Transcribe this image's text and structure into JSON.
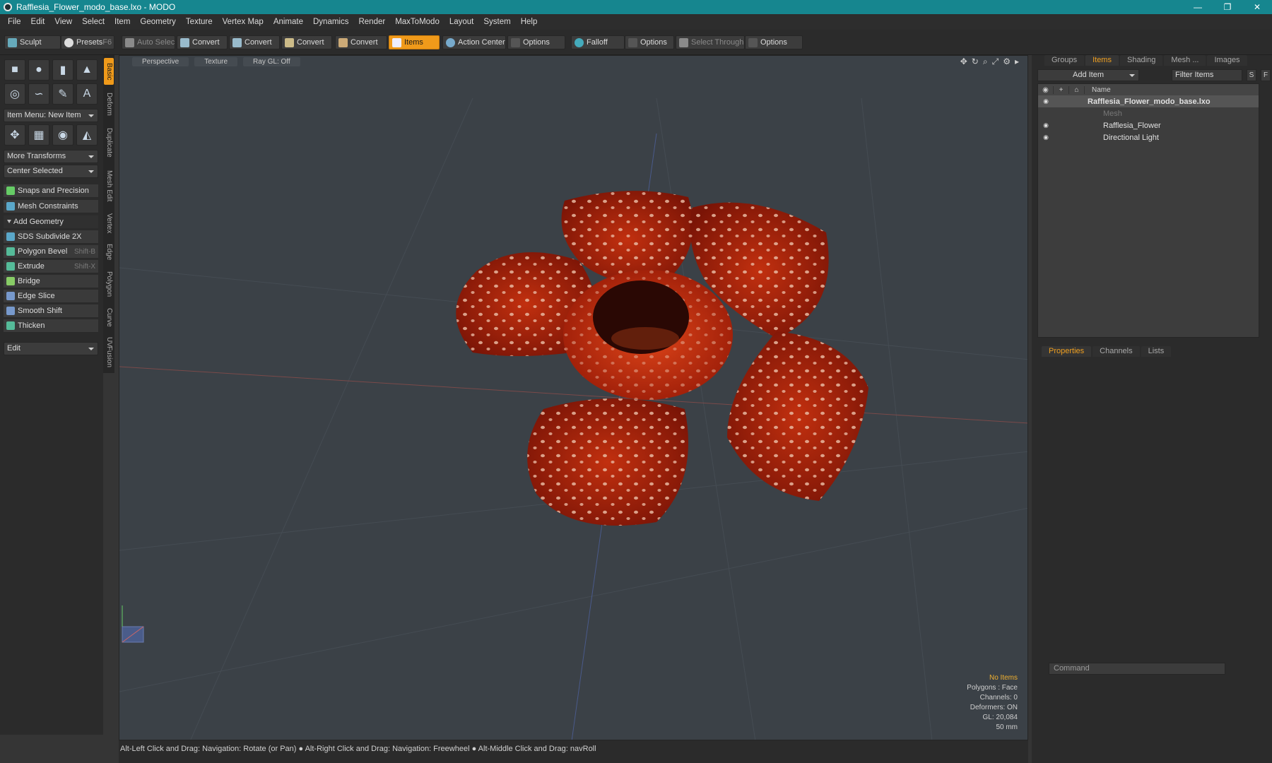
{
  "window": {
    "title": "Rafflesia_Flower_modo_base.lxo - MODO",
    "minimize": "—",
    "maximize": "❐",
    "close": "✕"
  },
  "menu": [
    "File",
    "Edit",
    "View",
    "Select",
    "Item",
    "Geometry",
    "Texture",
    "Vertex Map",
    "Animate",
    "Dynamics",
    "Render",
    "MaxToModo",
    "Layout",
    "System",
    "Help"
  ],
  "toolbar": {
    "sculpt": "Sculpt",
    "presets": "Presets",
    "presets_shortcut": "F6",
    "auto_select": "Auto Select",
    "convert1": "Convert",
    "convert2": "Convert",
    "convert3": "Convert",
    "convert4": "Convert",
    "items": "Items",
    "action_center": "Action Center",
    "options1": "Options",
    "falloff": "Falloff",
    "options2": "Options",
    "select_through": "Select Through",
    "options3": "Options"
  },
  "left": {
    "item_menu": "Item Menu: New Item",
    "more_transforms": "More Transforms",
    "center_selected": "Center Selected",
    "snaps": "Snaps and Precision",
    "mesh_constraints": "Mesh Constraints",
    "add_geometry": "Add Geometry",
    "tools": [
      {
        "label": "SDS Subdivide 2X",
        "shortcut": ""
      },
      {
        "label": "Polygon Bevel",
        "shortcut": "Shift-B"
      },
      {
        "label": "Extrude",
        "shortcut": "Shift-X"
      },
      {
        "label": "Bridge",
        "shortcut": ""
      },
      {
        "label": "Edge Slice",
        "shortcut": ""
      },
      {
        "label": "Smooth Shift",
        "shortcut": ""
      },
      {
        "label": "Thicken",
        "shortcut": ""
      }
    ],
    "edit": "Edit"
  },
  "vtabs": [
    "Basic",
    "Deform",
    "Duplicate",
    "Mesh Edit",
    "Vertex",
    "Edge",
    "Polygon",
    "Curve",
    "UV",
    "Fusion"
  ],
  "viewport": {
    "tabs": [
      "Perspective",
      "Texture",
      "Ray GL: Off"
    ],
    "info": {
      "no_items": "No Items",
      "polygons": "Polygons : Face",
      "channels": "Channels: 0",
      "deformers": "Deformers: ON",
      "gl": "GL: 20,084",
      "distance": "50 mm"
    }
  },
  "status": "Alt-Left Click and Drag: Navigation: Rotate (or Pan) ● Alt-Right Click and Drag: Navigation: Freewheel ● Alt-Middle Click and Drag: navRoll",
  "right": {
    "tabs": [
      "Groups",
      "Items",
      "Shading",
      "Mesh ...",
      "Images"
    ],
    "add_item": "Add Item",
    "filter_items": "Filter Items",
    "s_btn": "S",
    "f_btn": "F",
    "name_col": "Name",
    "tree": [
      "Rafflesia_Flower_modo_base.lxo",
      "Mesh",
      "Rafflesia_Flower",
      "Directional Light"
    ],
    "prop_tabs": [
      "Properties",
      "Channels",
      "Lists"
    ],
    "command_placeholder": "Command"
  },
  "colors": {
    "titlebar": "#16868f",
    "accent": "#f09a1a",
    "viewport_bg": "#3b4147",
    "flower": "#b0220c"
  }
}
